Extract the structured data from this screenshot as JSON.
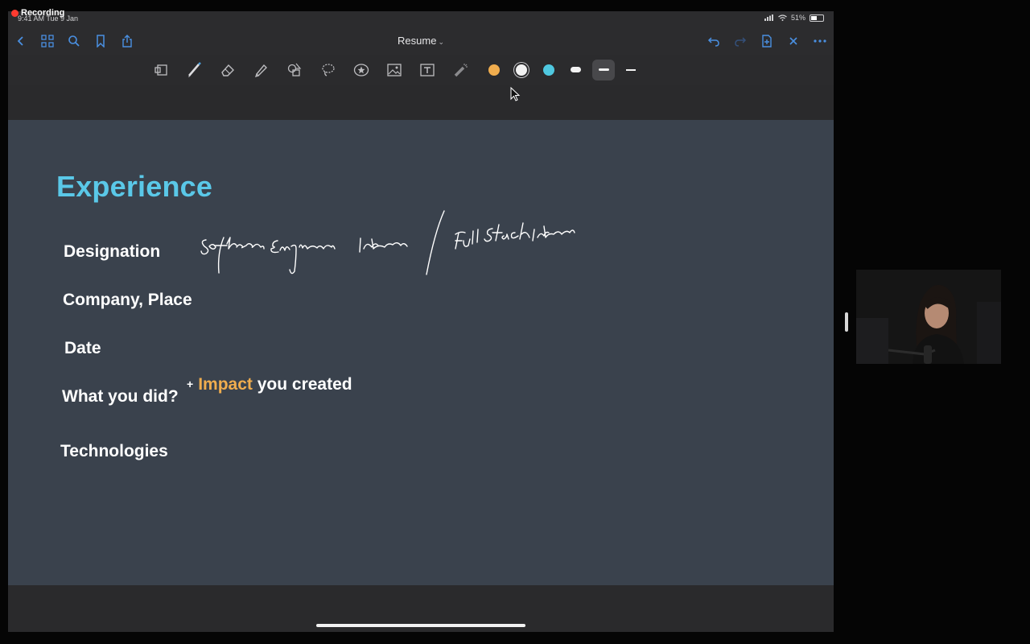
{
  "recording": {
    "label": "Recording"
  },
  "status_bar": {
    "time_date": "9:41 AM  Tue 9 Jan",
    "battery": "51%"
  },
  "nav": {
    "title": "Resume",
    "title_chevron": "⌄"
  },
  "toolbar": {
    "colors": [
      {
        "name": "orange",
        "hex": "#f0ad4e",
        "selected": false
      },
      {
        "name": "white",
        "hex": "#f2f2f2",
        "selected": true
      },
      {
        "name": "cyan",
        "hex": "#4fc8e0",
        "selected": false
      }
    ],
    "stroke_widths": [
      "thick",
      "medium",
      "thin"
    ],
    "selected_stroke": "medium"
  },
  "page": {
    "heading": "Experience",
    "labels": {
      "designation": "Designation",
      "company_place": "Company, Place",
      "date": "Date",
      "what_you_did": "What you did?",
      "technologies": "Technologies"
    },
    "impact_line": {
      "plus": "+",
      "impact": "Impact",
      "rest": "you created"
    },
    "handwriting": "Software Engineer Intern / Full Stack Intern"
  },
  "colors": {
    "page_bg": "#3a424d",
    "heading": "#5ac8e8",
    "impact": "#f0ad4e",
    "recording_dot": "#ff3b30"
  }
}
